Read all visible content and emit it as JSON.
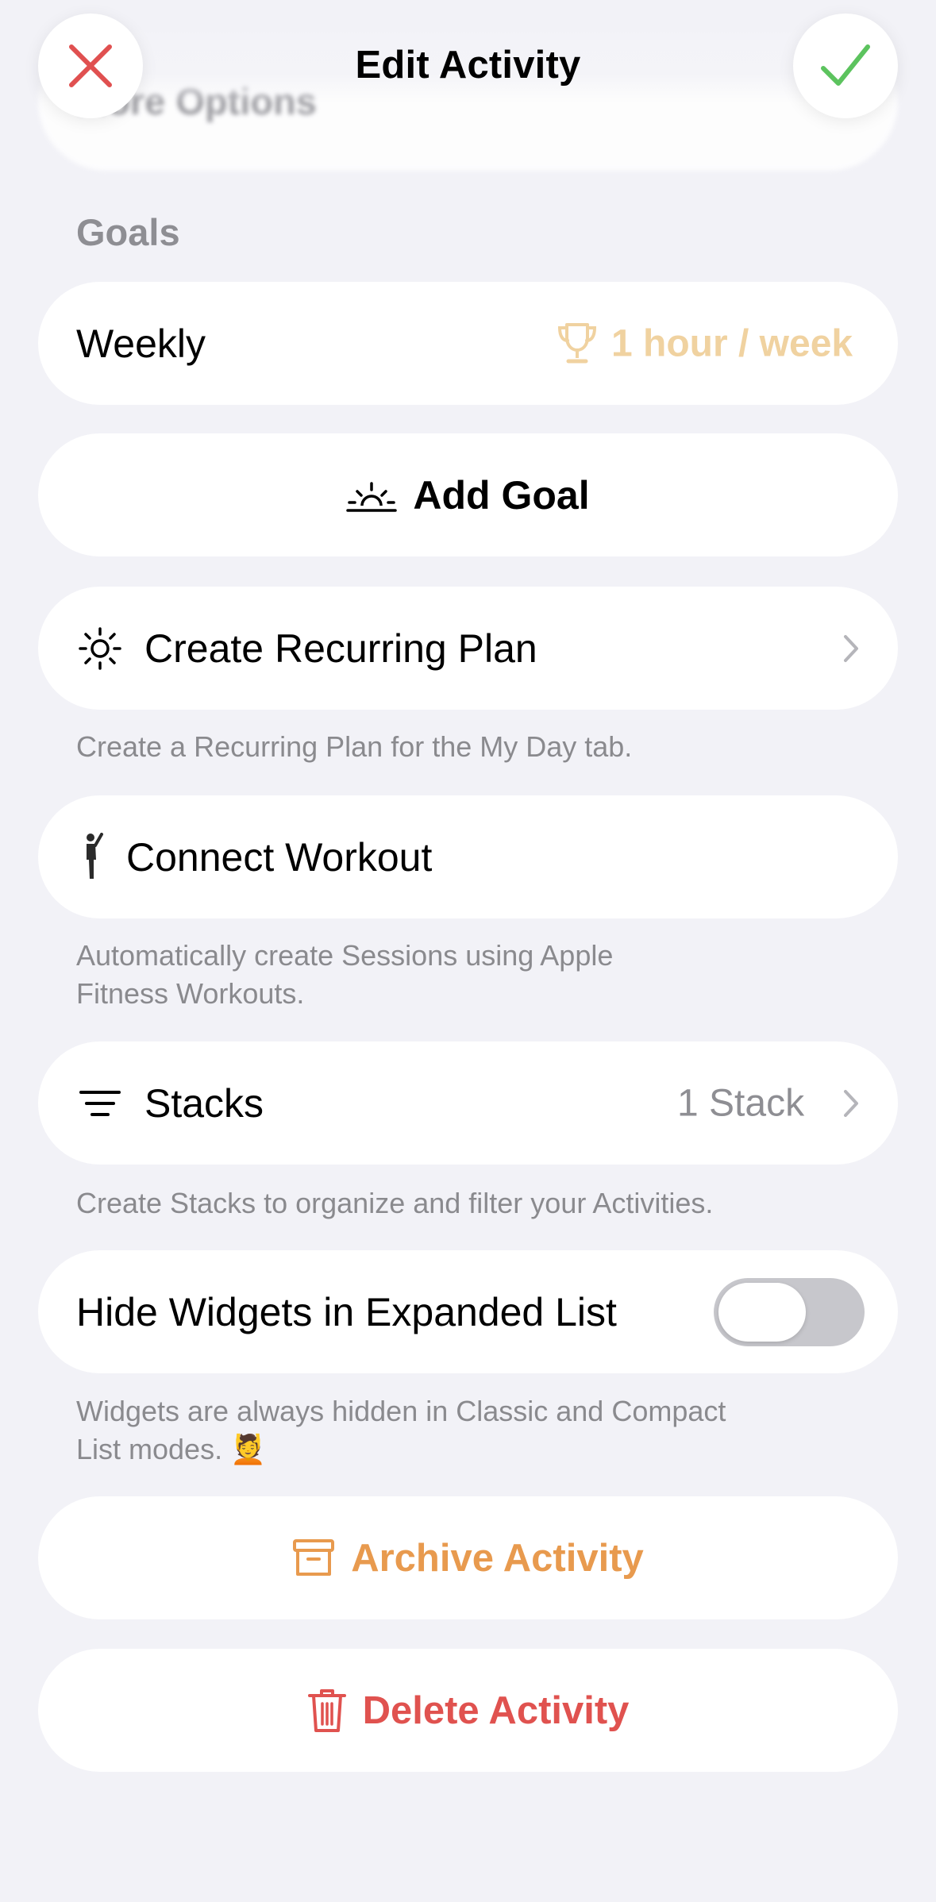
{
  "header": {
    "title": "Edit Activity",
    "behind_text": "More Options"
  },
  "goals": {
    "section_label": "Goals",
    "weekly_label": "Weekly",
    "weekly_value": "1 hour / week",
    "add_goal_label": "Add Goal"
  },
  "recurring": {
    "label": "Create Recurring Plan",
    "footnote": "Create a Recurring Plan for the My Day tab."
  },
  "workout": {
    "label": "Connect Workout",
    "footnote_line1": "Automatically create Sessions using Apple",
    "footnote_line2": "Fitness Workouts."
  },
  "stacks": {
    "label": "Stacks",
    "value": "1 Stack",
    "footnote": "Create Stacks to organize and filter your Activities."
  },
  "widgets": {
    "label": "Hide Widgets in Expanded List",
    "toggle_on": false,
    "footnote_line1": "Widgets are always hidden in Classic and Compact",
    "footnote_line2": "List modes.",
    "footnote_emoji": "💆"
  },
  "archive": {
    "label": "Archive Activity"
  },
  "delete": {
    "label": "Delete Activity"
  },
  "colors": {
    "accent_orange": "#e89a4e",
    "goal_gold": "#f0d2a0",
    "danger_red": "#e0524f",
    "check_green": "#5cc35e",
    "close_red": "#e05050"
  }
}
